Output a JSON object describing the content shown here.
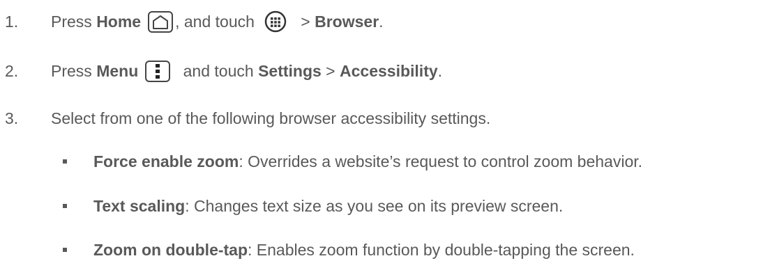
{
  "steps": [
    {
      "number": "1.",
      "t1": "Press ",
      "b1": "Home",
      "t2": ", and touch",
      "t3": " > ",
      "b2": "Browser",
      "t4": "."
    },
    {
      "number": "2.",
      "t1": "Press ",
      "b1": "Menu",
      "t2": " and touch ",
      "b2": "Settings",
      "t3": " > ",
      "b3": "Accessibility",
      "t4": "."
    },
    {
      "number": "3.",
      "text": "Select from one of the following browser accessibility settings."
    }
  ],
  "options": [
    {
      "name": "Force enable zoom",
      "description": ": Overrides a website’s request to control zoom behavior."
    },
    {
      "name": "Text scaling",
      "description": ": Changes text size as you see on its preview screen."
    },
    {
      "name": "Zoom on double-tap",
      "description": ": Enables zoom function by double-tapping the screen."
    }
  ],
  "icons": {
    "home": "home-icon",
    "apps": "apps-icon",
    "menu": "menu-icon"
  }
}
